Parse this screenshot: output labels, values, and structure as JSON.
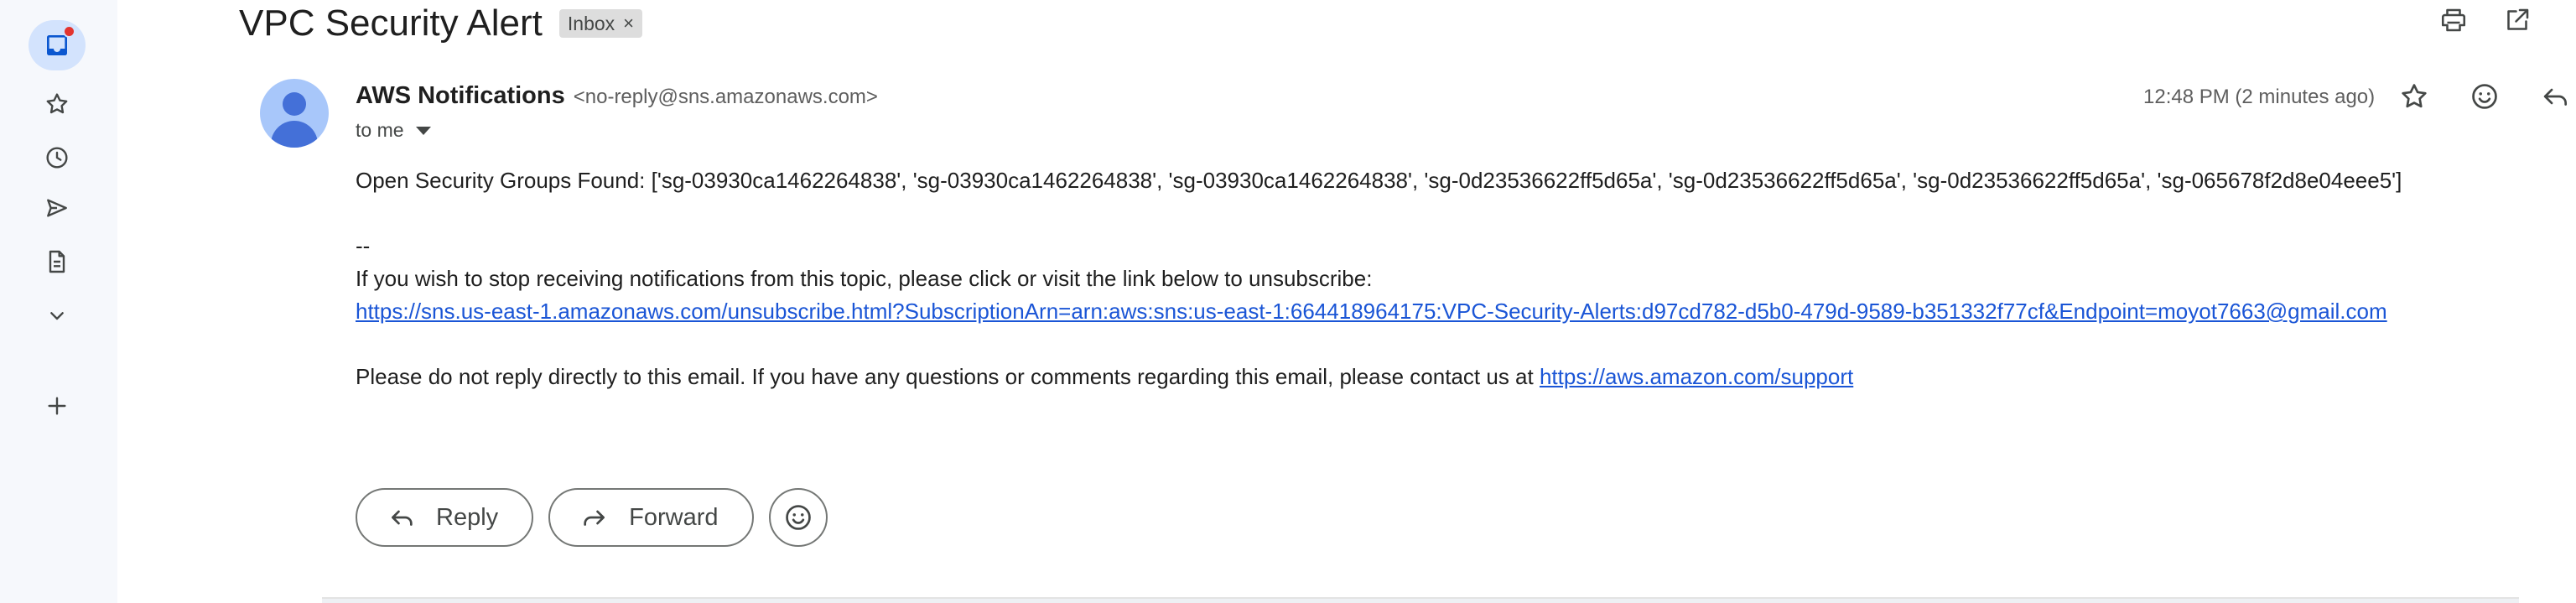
{
  "rail": {
    "items": [
      {
        "icon": "inbox-icon",
        "active": true,
        "unread_dot": true
      },
      {
        "icon": "star-icon"
      },
      {
        "icon": "clock-icon"
      },
      {
        "icon": "send-icon"
      },
      {
        "icon": "draft-icon"
      },
      {
        "icon": "chevron-down-icon"
      },
      {
        "icon": "plus-icon"
      }
    ]
  },
  "subject": {
    "title": "VPC Security Alert",
    "label_chip": "Inbox",
    "chip_remove": "×"
  },
  "message": {
    "sender_name": "AWS Notifications",
    "sender_email": "<no-reply@sns.amazonaws.com>",
    "to": "to me",
    "time": "12:48 PM (2 minutes ago)",
    "body": {
      "line1": "Open Security Groups Found: ['sg-03930ca1462264838', 'sg-03930ca1462264838', 'sg-03930ca1462264838', 'sg-0d23536622ff5d65a', 'sg-0d23536622ff5d65a', 'sg-0d23536622ff5d65a', 'sg-065678f2d8e04eee5']",
      "separator": "--",
      "unsubscribe_text": "If you wish to stop receiving notifications from this topic, please click or visit the link below to unsubscribe:",
      "unsubscribe_link": "https://sns.us-east-1.amazonaws.com/unsubscribe.html?SubscriptionArn=arn:aws:sns:us-east-1:664418964175:VPC-Security-Alerts:d97cd782-d5b0-479d-9589-b351332f77cf&Endpoint=moyot7663@gmail.com",
      "support_text": "Please do not reply directly to this email. If you have any questions or comments regarding this email, please contact us at ",
      "support_link": "https://aws.amazon.com/support"
    }
  },
  "actions": {
    "reply": "Reply",
    "forward": "Forward"
  },
  "colors": {
    "accent": "#1a55d6",
    "active_pill": "#d3e3fd",
    "avatar_bg": "#a8c7fa",
    "avatar_fg": "#4470d8",
    "unread": "#e3342f"
  }
}
